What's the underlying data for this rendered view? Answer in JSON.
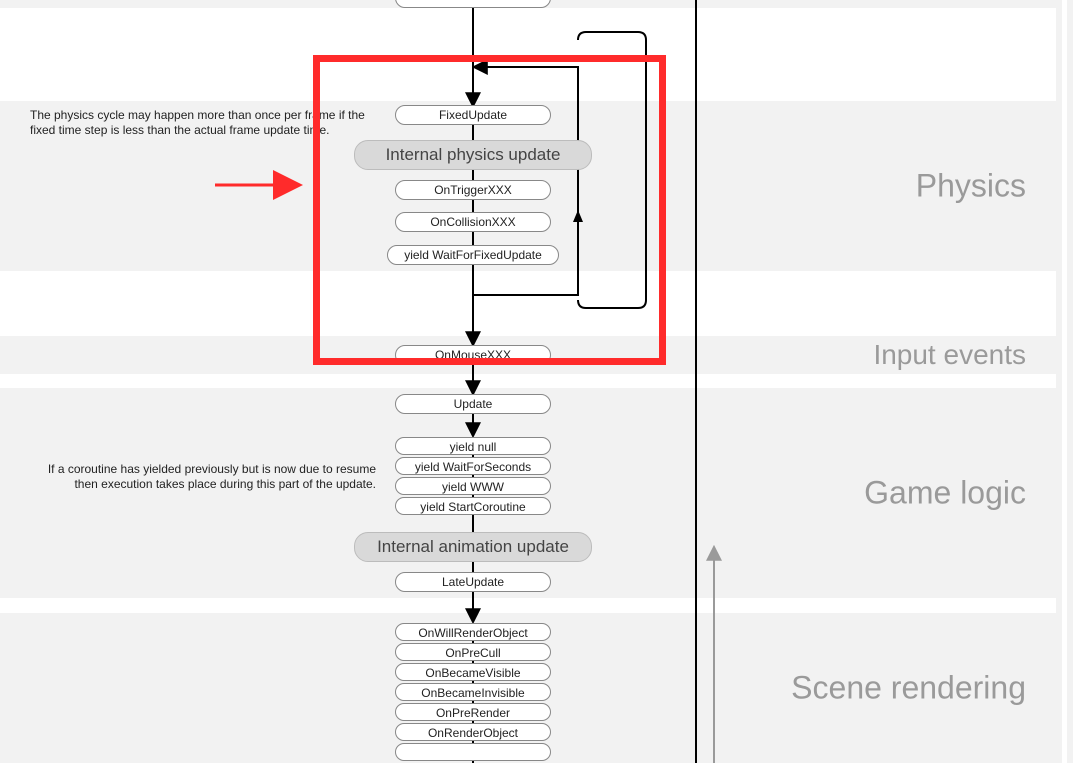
{
  "sections": {
    "physics": {
      "label": "Physics"
    },
    "input": {
      "label": "Input events"
    },
    "game": {
      "label": "Game logic"
    },
    "scene": {
      "label": "Scene rendering"
    }
  },
  "captions": {
    "physics_note": "The physics cycle may happen more than once per frame if the fixed time step is less than the actual frame update time.",
    "coroutine_note": "If a coroutine has yielded previously but is now due to resume then execution takes place during this part of the update."
  },
  "nodes": {
    "fixed_update": "FixedUpdate",
    "internal_physics": "Internal physics update",
    "on_trigger": "OnTriggerXXX",
    "on_collision": "OnCollisionXXX",
    "yield_wait_fixed": "yield WaitForFixedUpdate",
    "on_mouse": "OnMouseXXX",
    "update": "Update",
    "yield_null": "yield null",
    "yield_wfs": "yield WaitForSeconds",
    "yield_www": "yield WWW",
    "yield_sc": "yield StartCoroutine",
    "internal_anim": "Internal animation update",
    "late_update": "LateUpdate",
    "on_will_render": "OnWillRenderObject",
    "on_precull": "OnPreCull",
    "on_became_visible": "OnBecameVisible",
    "on_became_invisible": "OnBecameInvisible",
    "on_prerender": "OnPreRender",
    "on_render_object": "OnRenderObject"
  }
}
